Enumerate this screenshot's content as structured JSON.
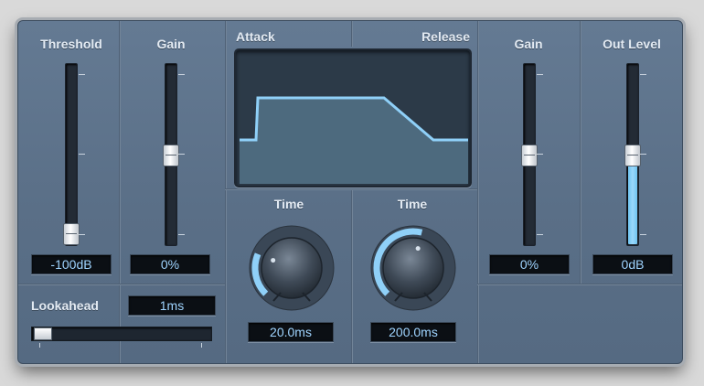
{
  "threshold": {
    "label": "Threshold",
    "value": "-100dB",
    "level": 0.02
  },
  "gain_in": {
    "label": "Gain",
    "value": "0%",
    "level": 0.5
  },
  "lookahead": {
    "label": "Lookahead",
    "value": "1ms",
    "level": 0.0
  },
  "envelope": {
    "attack_label": "Attack",
    "release_label": "Release"
  },
  "attack_time": {
    "label": "Time",
    "value": "20.0ms",
    "level": 0.25
  },
  "release_time": {
    "label": "Time",
    "value": "200.0ms",
    "level": 0.55
  },
  "gain_out": {
    "label": "Gain",
    "value": "0%",
    "level": 0.5
  },
  "out_level": {
    "label": "Out Level",
    "value": "0dB",
    "level": 0.5
  },
  "colors": {
    "panel": "#5f7590",
    "accent": "#8fd0f8",
    "display_text": "#9fd4ff",
    "label_text": "#e3eaf2"
  }
}
